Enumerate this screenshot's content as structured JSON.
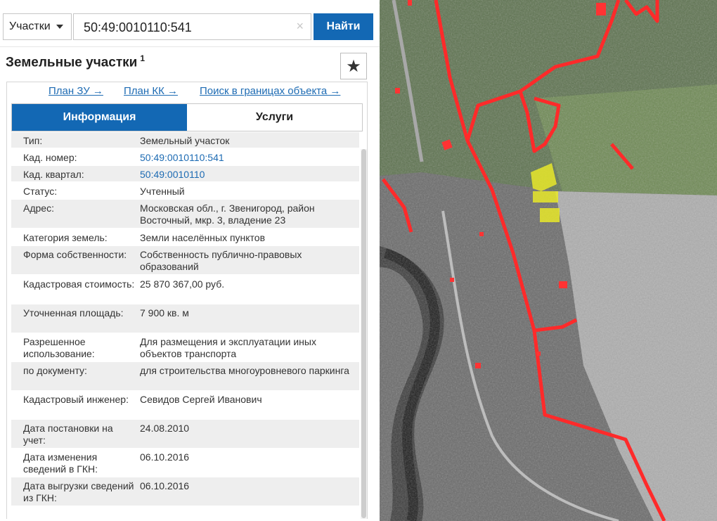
{
  "search": {
    "type_label": "Участки",
    "query": "50:49:0010110:541",
    "submit_label": "Найти",
    "clear_glyph": "×"
  },
  "panel": {
    "title": "Земельные участки",
    "title_count": "1",
    "favorite_icon": "star-icon",
    "links": [
      {
        "label": "План ЗУ →"
      },
      {
        "label": "План КК →"
      },
      {
        "label": "Поиск в границах объекта →"
      }
    ],
    "tabs": [
      {
        "label": "Информация",
        "active": true
      },
      {
        "label": "Услуги",
        "active": false
      }
    ],
    "rows": [
      {
        "label": "Тип:",
        "value": "Земельный участок"
      },
      {
        "label": "Кад. номер:",
        "value": "50:49:0010110:541",
        "link": true
      },
      {
        "label": "Кад. квартал:",
        "value": "50:49:0010110",
        "link": true
      },
      {
        "label": "Статус:",
        "value": "Учтенный"
      },
      {
        "label": "Адрес:",
        "value": "Московская обл., г. Звенигород, район Восточный, мкр. 3, владение 23"
      },
      {
        "label": "Категория земель:",
        "value": "Земли населённых пунктов"
      },
      {
        "label": "Форма собственности:",
        "value": "Собственность публично-правовых образований"
      },
      {
        "label": "Кадастровая стоимость:",
        "value": "25 870 367,00 руб."
      },
      {
        "label": "Уточненная площадь:",
        "value": "7 900 кв. м"
      },
      {
        "label": "Разрешенное использование:",
        "value": "Для размещения и эксплуатации иных объектов транспорта"
      },
      {
        "label": "по документу:",
        "value": "для строительства многоуровневого паркинга"
      },
      {
        "label": "Кадастровый инженер:",
        "value": "Севидов Сергей Иванович"
      },
      {
        "label": "Дата постановки на учет:",
        "value": "24.08.2010"
      },
      {
        "label": "Дата изменения сведений в ГКН:",
        "value": "06.10.2016"
      },
      {
        "label": "Дата выгрузки сведений из ГКН:",
        "value": "06.10.2016"
      }
    ]
  },
  "colors": {
    "accent": "#1368b4",
    "link": "#1d6bb3",
    "boundary": "#ff2a2a",
    "selected_parcel": "#e8e82a"
  }
}
